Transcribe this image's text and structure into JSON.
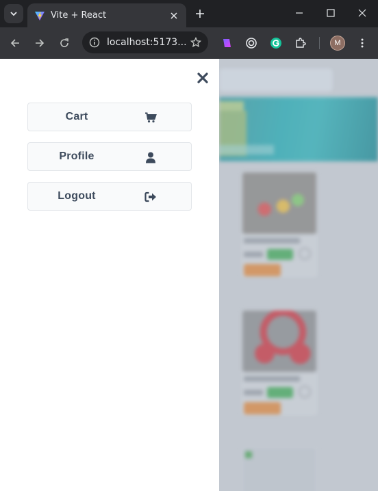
{
  "browser": {
    "tab": {
      "title": "Vite + React",
      "favicon": "vite-logo-icon"
    },
    "address_bar": {
      "url": "localhost:5173..."
    },
    "profile": {
      "initial": "M"
    },
    "extensions": [
      "clipboard-extension-icon",
      "circle-extension-icon",
      "grammarly-icon",
      "puzzle-icon"
    ]
  },
  "drawer": {
    "close_icon": "close-icon",
    "items": [
      {
        "label": "Cart",
        "icon": "cart-icon"
      },
      {
        "label": "Profile",
        "icon": "user-icon"
      },
      {
        "label": "Logout",
        "icon": "sign-out-icon"
      }
    ]
  },
  "colors": {
    "drawer_text": "#3d4a5c",
    "button_bg": "#f9fafb",
    "button_border": "#e2e5e9",
    "banner_teal": "#1fb0b8",
    "price_green": "#3fae55",
    "add_orange": "#e88b3a"
  }
}
